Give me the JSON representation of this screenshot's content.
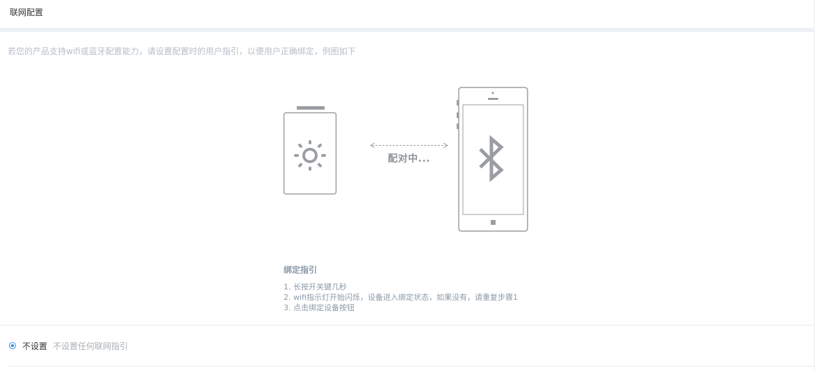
{
  "header": {
    "title": "联网配置"
  },
  "hint": "若您的产品支持wifi或蓝牙配置能力，请设置配置时的用户指引，以便用户正确绑定，例图如下",
  "illustration": {
    "pairing_text": "配对中...",
    "device_icon": "sun-icon",
    "phone_icon": "bluetooth-icon"
  },
  "guide": {
    "title": "绑定指引",
    "steps": [
      "1. 长按开关键几秒",
      "2. wifi指示灯开始闪烁，设备进入绑定状态，如果没有，请重复步骤1",
      "3. 点击绑定设备按钮"
    ]
  },
  "options": [
    {
      "label": "不设置",
      "description": "不设置任何联网指引",
      "selected": true
    }
  ],
  "colors": {
    "accent": "#2d8cf0",
    "illustration_stroke": "#9a9ea3",
    "muted_text": "#b7bec6"
  }
}
